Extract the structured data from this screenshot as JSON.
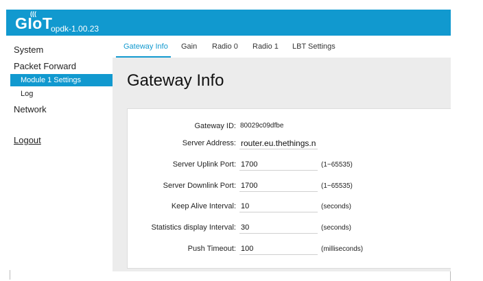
{
  "header": {
    "logo_text": "GIoT",
    "version": "opdk-1.00.23",
    "accent_color": "#1199cf"
  },
  "sidebar": {
    "items": [
      {
        "label": "System"
      },
      {
        "label": "Packet Forward"
      },
      {
        "label": "Module 1 Settings",
        "active": true
      },
      {
        "label": "Log"
      },
      {
        "label": "Network"
      },
      {
        "label": "Logout"
      }
    ]
  },
  "tabs": [
    {
      "label": "Gateway Info",
      "active": true
    },
    {
      "label": "Gain"
    },
    {
      "label": "Radio 0"
    },
    {
      "label": "Radio 1"
    },
    {
      "label": "LBT Settings"
    }
  ],
  "page": {
    "title": "Gateway Info"
  },
  "form": {
    "gateway_id": {
      "label": "Gateway ID:",
      "value": "80029c09dfbe"
    },
    "server_address": {
      "label": "Server Address:",
      "value": "router.eu.thethings.net"
    },
    "uplink_port": {
      "label": "Server Uplink Port:",
      "value": "1700",
      "hint": "(1~65535)"
    },
    "downlink_port": {
      "label": "Server Downlink Port:",
      "value": "1700",
      "hint": "(1~65535)"
    },
    "keep_alive": {
      "label": "Keep Alive Interval:",
      "value": "10",
      "hint": "(seconds)"
    },
    "stats_interval": {
      "label": "Statistics display Interval:",
      "value": "30",
      "hint": "(seconds)"
    },
    "push_timeout": {
      "label": "Push Timeout:",
      "value": "100",
      "hint": "(milliseconds)"
    }
  }
}
